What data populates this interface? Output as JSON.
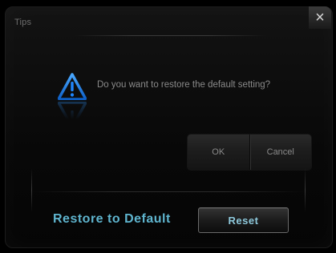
{
  "dialog": {
    "title": "Tips",
    "message": "Do you want to restore the default setting?",
    "ok_label": "OK",
    "cancel_label": "Cancel",
    "close_glyph": "×",
    "icon": "warning-triangle-icon"
  },
  "settings": {
    "restore_label": "Restore to Default",
    "reset_label": "Reset"
  },
  "colors": {
    "accent": "#5fb5cf",
    "warning_icon": "#1e7fe6",
    "background": "#000000"
  }
}
